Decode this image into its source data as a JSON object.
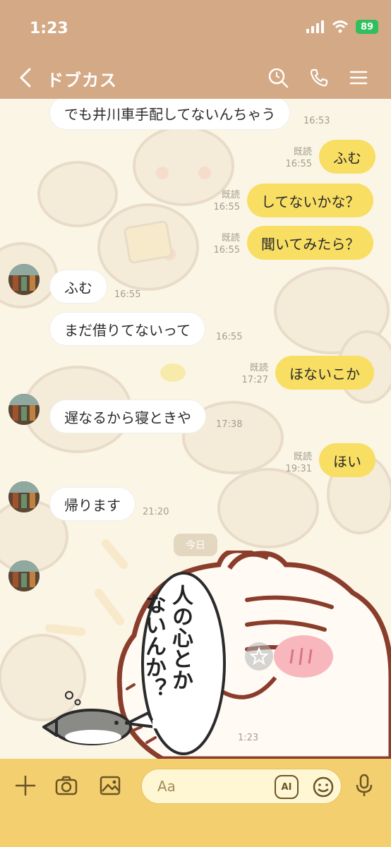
{
  "status": {
    "time": "1:23",
    "battery": "89"
  },
  "header": {
    "title": "ドブカス"
  },
  "messages": [
    {
      "text": "でも井川車手配してないんちゃう",
      "time": "16:53"
    },
    {
      "text": "ふむ",
      "read": "既読",
      "time": "16:55"
    },
    {
      "text": "してないかな？",
      "read": "既読",
      "time": "16:55"
    },
    {
      "text": "聞いてみたら？",
      "read": "既読",
      "time": "16:55"
    },
    {
      "text": "ふむ",
      "time": "16:55"
    },
    {
      "text": "まだ借りてないって",
      "time": "16:55"
    },
    {
      "text": "ほないこか",
      "read": "既読",
      "time": "17:27"
    },
    {
      "text": "遅なるから寝ときや",
      "time": "17:38"
    },
    {
      "text": "ほい",
      "read": "既読",
      "time": "19:31"
    },
    {
      "text": "帰ります",
      "time": "21:20"
    }
  ],
  "date_divider": "今日",
  "sticker": {
    "speech_line1": "人の心とか",
    "speech_line2": "ないんか？",
    "time": "1:23"
  },
  "input": {
    "placeholder": "Aa",
    "ai_label": "AI"
  },
  "colors": {
    "header": "#d4a985",
    "outgoing": "#f8de63",
    "input_bar": "#f3cf6f"
  }
}
